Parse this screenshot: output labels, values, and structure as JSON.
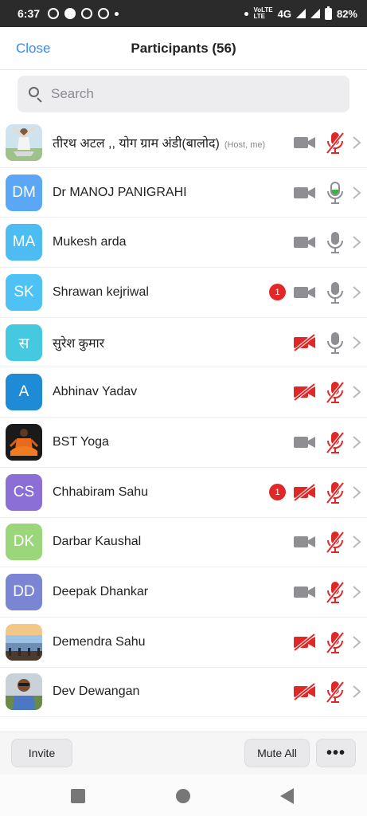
{
  "status_bar": {
    "time": "6:37",
    "network_type_top": "VoLTE",
    "network_type_bottom": "LTE",
    "network": "4G",
    "battery": "82%"
  },
  "header": {
    "close_label": "Close",
    "title": "Participants (56)"
  },
  "search": {
    "placeholder": "Search"
  },
  "participants": [
    {
      "name": "तीरथ अटल ,, योग ग्राम अंडी(बालोद)",
      "role": "(Host, me)",
      "avatar_type": "photo-yoga",
      "video": "off",
      "mic": "muted",
      "badge": ""
    },
    {
      "name": "Dr MANOJ PANIGRAHI",
      "initials": "DM",
      "avatar_color": "#5aa8f5",
      "video": "off",
      "mic": "active",
      "badge": ""
    },
    {
      "name": "Mukesh arda",
      "initials": "MA",
      "avatar_color": "#4dbcf3",
      "video": "off",
      "mic": "on",
      "badge": ""
    },
    {
      "name": "Shrawan kejriwal",
      "initials": "SK",
      "avatar_color": "#4ec2f5",
      "video": "off",
      "mic": "on",
      "badge": "1"
    },
    {
      "name": "सुरेश कुमार",
      "initials": "स",
      "avatar_color": "#45c9e0",
      "video": "stopped",
      "mic": "on",
      "badge": ""
    },
    {
      "name": "Abhinav Yadav",
      "initials": "A",
      "avatar_color": "#1f8bd6",
      "video": "stopped",
      "mic": "muted",
      "badge": ""
    },
    {
      "name": "BST Yoga",
      "avatar_type": "photo-meditation",
      "video": "off",
      "mic": "muted",
      "badge": ""
    },
    {
      "name": "Chhabiram Sahu",
      "initials": "CS",
      "avatar_color": "#8c6fd6",
      "video": "stopped",
      "mic": "muted",
      "badge": "1"
    },
    {
      "name": "Darbar Kaushal",
      "initials": "DK",
      "avatar_color": "#9cd67a",
      "video": "off",
      "mic": "muted",
      "badge": ""
    },
    {
      "name": "Deepak Dhankar",
      "initials": "DD",
      "avatar_color": "#7a86d4",
      "video": "off",
      "mic": "muted",
      "badge": ""
    },
    {
      "name": "Demendra Sahu",
      "avatar_type": "photo-landscape",
      "video": "stopped",
      "mic": "muted",
      "badge": ""
    },
    {
      "name": "Dev Dewangan",
      "avatar_type": "photo-person",
      "video": "stopped",
      "mic": "muted",
      "badge": ""
    }
  ],
  "footer": {
    "invite_label": "Invite",
    "mute_all_label": "Mute All",
    "more_label": "•••"
  },
  "colors": {
    "accent": "#2d8cff",
    "muted_red": "#e02828",
    "active_green": "#3cb043",
    "icon_gray": "#8e8e93"
  },
  "icons": {
    "video": "video-camera-icon",
    "video_stopped": "video-stopped-icon",
    "mic": "microphone-icon",
    "mic_muted": "microphone-muted-icon",
    "chevron": "chevron-right-icon",
    "search": "search-icon"
  }
}
